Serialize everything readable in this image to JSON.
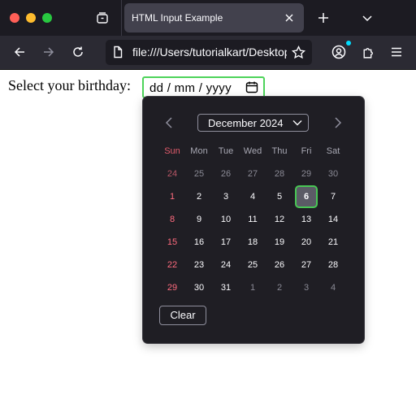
{
  "browser": {
    "tab_title": "HTML Input Example",
    "url": "file:///Users/tutorialkart/Desktop/index.html",
    "icons": {
      "close": "close-icon",
      "minimize": "minimize-icon",
      "maximize": "maximize-icon",
      "tabs": "tab-overview-icon",
      "tab_close": "x-icon",
      "new_tab": "plus-icon",
      "tab_list": "chevron-down-icon",
      "back": "back-arrow-icon",
      "forward": "forward-arrow-icon",
      "reload": "reload-icon",
      "page": "document-icon",
      "bookmark": "star-icon",
      "account": "account-icon",
      "extensions": "puzzle-icon",
      "menu": "hamburger-icon"
    },
    "colors": {
      "tab_strip": "#1c1b22",
      "toolbar": "#2b2a33",
      "focus": "#4dd35a"
    }
  },
  "page": {
    "label": "Select your birthday:",
    "date_placeholder": "dd / mm / yyyy"
  },
  "picker": {
    "month_year": "December 2024",
    "weekdays": [
      "Sun",
      "Mon",
      "Tue",
      "Wed",
      "Thu",
      "Fri",
      "Sat"
    ],
    "weeks": [
      [
        "24",
        "25",
        "26",
        "27",
        "28",
        "29",
        "30"
      ],
      [
        "1",
        "2",
        "3",
        "4",
        "5",
        "6",
        "7"
      ],
      [
        "8",
        "9",
        "10",
        "11",
        "12",
        "13",
        "14"
      ],
      [
        "15",
        "16",
        "17",
        "18",
        "19",
        "20",
        "21"
      ],
      [
        "22",
        "23",
        "24",
        "25",
        "26",
        "27",
        "28"
      ],
      [
        "29",
        "30",
        "31",
        "1",
        "2",
        "3",
        "4"
      ]
    ],
    "selected": "6",
    "clear_label": "Clear"
  }
}
